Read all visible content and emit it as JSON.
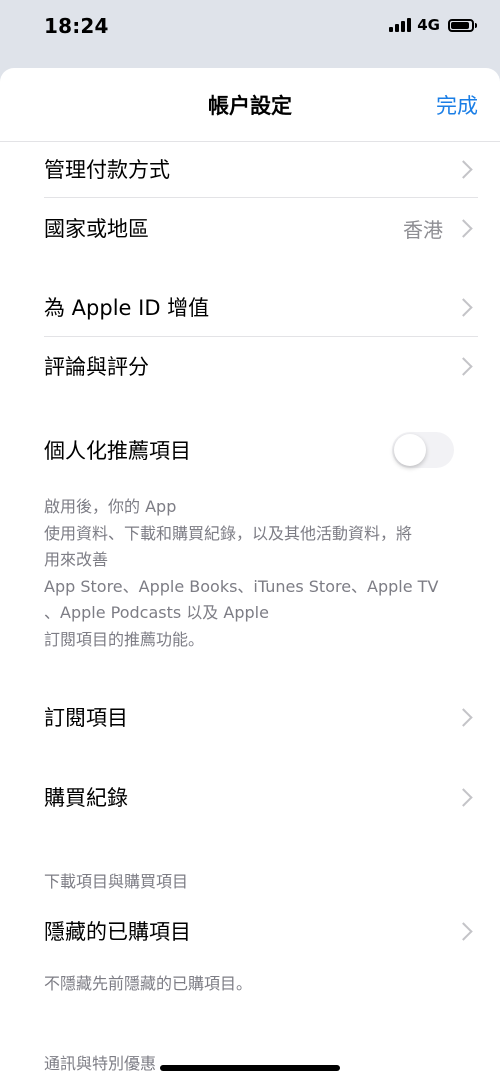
{
  "status_bar": {
    "time": "18:24",
    "network": "4G"
  },
  "header": {
    "title": "帳户設定",
    "done_label": "完成"
  },
  "rows": {
    "manage_payment": "管理付款方式",
    "country_region": {
      "label": "國家或地區",
      "value": "香港"
    },
    "add_funds": "為 Apple ID 增值",
    "ratings_reviews": "評論與評分",
    "personalized": {
      "label": "個人化推薦項目",
      "enabled": false
    },
    "subscriptions": "訂閱項目",
    "purchase_history": "購買紀錄",
    "hidden_purchases": "隱藏的已購項目"
  },
  "footnotes": {
    "personalized_lines": [
      "啟用後，你的 App",
      "使用資料、下載和購買紀錄，以及其他活動資料，將",
      "用來改善",
      "App Store、Apple Books、iTunes Store、Apple TV",
      "、Apple Podcasts 以及 Apple",
      "訂閱項目的推薦功能。"
    ],
    "hidden_purchases": "不隱藏先前隱藏的已購項目。"
  },
  "sections": {
    "downloads_purchases": "下載項目與購買項目",
    "newsletters": "通訊與特別優惠"
  }
}
